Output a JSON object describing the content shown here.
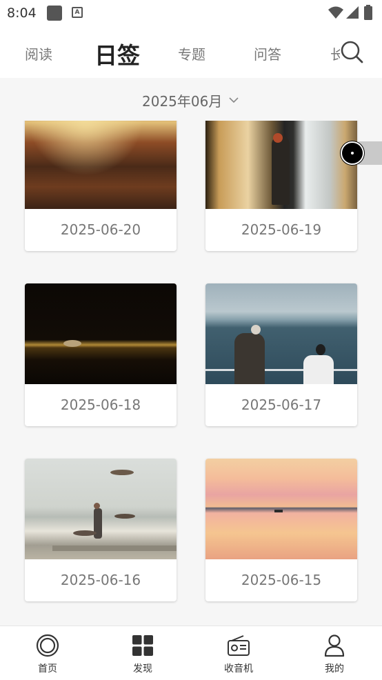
{
  "status_bar": {
    "time": "8:04"
  },
  "top_tabs": {
    "items": [
      {
        "label": "阅读",
        "active": false
      },
      {
        "label": "日签",
        "active": true
      },
      {
        "label": "专题",
        "active": false
      },
      {
        "label": "问答",
        "active": false
      },
      {
        "label": "长",
        "active": false
      }
    ],
    "search_icon": "search-icon"
  },
  "month_selector": {
    "label": "2025年06月",
    "icon": "chevron-down-icon"
  },
  "cards": [
    {
      "date": "2025-06-20"
    },
    {
      "date": "2025-06-19"
    },
    {
      "date": "2025-06-18"
    },
    {
      "date": "2025-06-17"
    },
    {
      "date": "2025-06-16"
    },
    {
      "date": "2025-06-15"
    }
  ],
  "bottom_nav": {
    "items": [
      {
        "label": "首页",
        "icon": "home-ring-icon"
      },
      {
        "label": "发现",
        "icon": "grid-icon"
      },
      {
        "label": "收音机",
        "icon": "radio-icon"
      },
      {
        "label": "我的",
        "icon": "person-icon"
      }
    ]
  },
  "colors": {
    "active_tab": "#222222",
    "inactive_tab": "#777777",
    "content_background": "#f6f6f6",
    "date_text": "#777777"
  }
}
